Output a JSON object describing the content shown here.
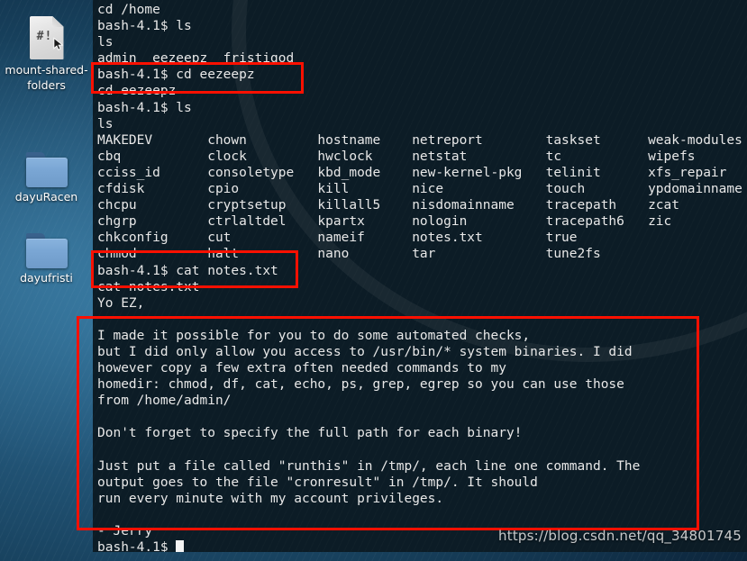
{
  "desktop": {
    "icons": [
      {
        "label": "mount-shared-folders",
        "icon": "script-file-icon",
        "glyph": "#!"
      },
      {
        "label": "dayuRacen",
        "icon": "folder-icon"
      },
      {
        "label": "dayufristi",
        "icon": "folder-icon"
      }
    ]
  },
  "terminal": {
    "prompt": "bash-4.1$",
    "lines": [
      "cd /home",
      "bash-4.1$ ls",
      "ls",
      "admin  eezeepz  fristigod",
      "bash-4.1$ cd eezeepz",
      "cd eezeepz",
      "bash-4.1$ ls",
      "ls",
      "MAKEDEV       chown         hostname    netreport        taskset      weak-modules",
      "cbq           clock         hwclock     netstat          tc           wipefs",
      "cciss_id      consoletype   kbd_mode    new-kernel-pkg   telinit      xfs_repair",
      "cfdisk        cpio          kill        nice             touch        ypdomainname",
      "chcpu         cryptsetup    killall5    nisdomainname    tracepath    zcat",
      "chgrp         ctrlaltdel    kpartx      nologin          tracepath6   zic",
      "chkconfig     cut           nameif      notes.txt        true",
      "chmod         halt          nano        tar              tune2fs",
      "bash-4.1$ cat notes.txt",
      "cat notes.txt",
      "Yo EZ,",
      "",
      "I made it possible for you to do some automated checks,",
      "but I did only allow you access to /usr/bin/* system binaries. I did",
      "however copy a few extra often needed commands to my",
      "homedir: chmod, df, cat, echo, ps, grep, egrep so you can use those",
      "from /home/admin/",
      "",
      "Don't forget to specify the full path for each binary!",
      "",
      "Just put a file called \"runthis\" in /tmp/, each line one command. The",
      "output goes to the file \"cronresult\" in /tmp/. It should",
      "run every minute with my account privileges.",
      "",
      "- Jerry"
    ],
    "final_prompt": "bash-4.1$ "
  },
  "annotations": {
    "color": "#fc1000",
    "boxes": [
      {
        "name": "cd-eezeepz-highlight"
      },
      {
        "name": "cat-notes-highlight"
      },
      {
        "name": "notes-content-highlight"
      }
    ]
  },
  "watermark": {
    "text": "https://blog.csdn.net/qq_34801745"
  }
}
